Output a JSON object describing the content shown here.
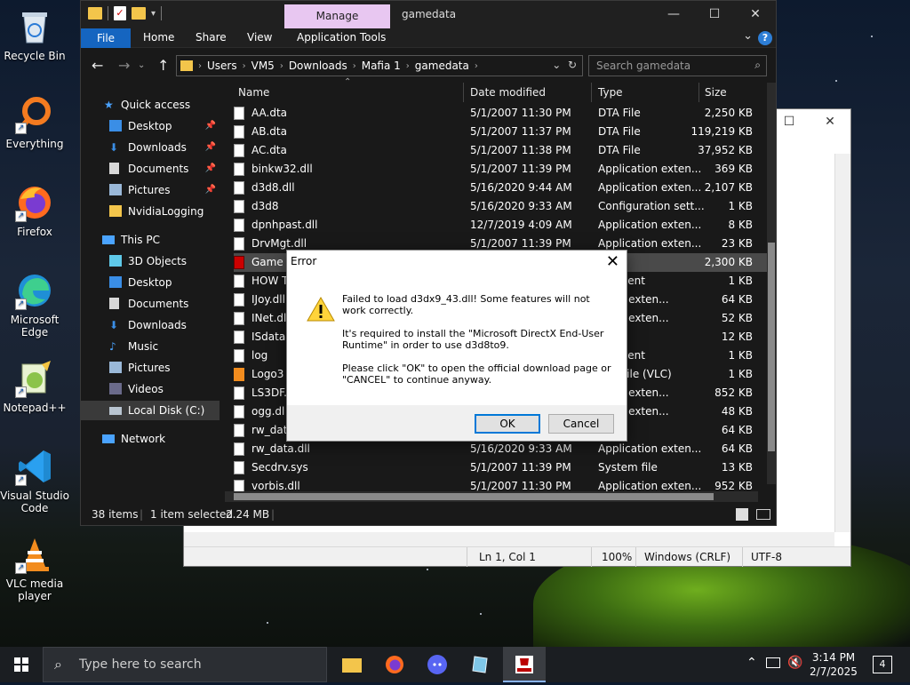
{
  "desktop": {
    "icons": [
      {
        "label": "Recycle Bin"
      },
      {
        "label": "Everything"
      },
      {
        "label": "Firefox"
      },
      {
        "label": "Microsoft Edge"
      },
      {
        "label": "Notepad++"
      },
      {
        "label": "Visual Studio Code"
      },
      {
        "label": "VLC media player"
      }
    ]
  },
  "notepad": {
    "status": {
      "position": "Ln 1, Col 1",
      "zoom": "100%",
      "line_endings": "Windows (CRLF)",
      "encoding": "UTF-8"
    }
  },
  "explorer": {
    "manage_tab": "Manage",
    "title": "gamedata",
    "ribbon": {
      "file": "File",
      "home": "Home",
      "share": "Share",
      "view": "View",
      "app_tools": "Application Tools"
    },
    "address": [
      "Users",
      "VM5",
      "Downloads",
      "Mafia 1",
      "gamedata"
    ],
    "search_placeholder": "Search gamedata",
    "nav": {
      "quick_access": "Quick access",
      "desktop": "Desktop",
      "downloads": "Downloads",
      "documents": "Documents",
      "pictures": "Pictures",
      "nvidia": "NvidiaLogging",
      "this_pc": "This PC",
      "objects3d": "3D Objects",
      "desktop2": "Desktop",
      "documents2": "Documents",
      "downloads2": "Downloads",
      "music": "Music",
      "pictures2": "Pictures",
      "videos": "Videos",
      "local_disk": "Local Disk (C:)",
      "network": "Network"
    },
    "columns": {
      "name": "Name",
      "date": "Date modified",
      "type": "Type",
      "size": "Size"
    },
    "files": [
      {
        "name": "AA.dta",
        "date": "5/1/2007 11:30 PM",
        "type": "DTA File",
        "size": "2,250 KB"
      },
      {
        "name": "AB.dta",
        "date": "5/1/2007 11:37 PM",
        "type": "DTA File",
        "size": "119,219 KB"
      },
      {
        "name": "AC.dta",
        "date": "5/1/2007 11:38 PM",
        "type": "DTA File",
        "size": "37,952 KB"
      },
      {
        "name": "binkw32.dll",
        "date": "5/1/2007 11:39 PM",
        "type": "Application exten...",
        "size": "369 KB"
      },
      {
        "name": "d3d8.dll",
        "date": "5/16/2020 9:44 AM",
        "type": "Application exten...",
        "size": "2,107 KB"
      },
      {
        "name": "d3d8",
        "date": "5/16/2020 9:33 AM",
        "type": "Configuration sett...",
        "size": "1 KB"
      },
      {
        "name": "dpnhpast.dll",
        "date": "12/7/2019 4:09 AM",
        "type": "Application exten...",
        "size": "8 KB"
      },
      {
        "name": "DrvMgt.dll",
        "date": "5/1/2007 11:39 PM",
        "type": "Application exten...",
        "size": "23 KB"
      },
      {
        "name": "Game",
        "date": "",
        "type": "ation",
        "size": "2,300 KB"
      },
      {
        "name": "HOW T",
        "date": "",
        "type": "ocument",
        "size": "1 KB"
      },
      {
        "name": "IJoy.dll",
        "date": "",
        "type": "ation exten...",
        "size": "64 KB"
      },
      {
        "name": "INet.dll",
        "date": "",
        "type": "ation exten...",
        "size": "52 KB"
      },
      {
        "name": "ISdata.",
        "date": "",
        "type": "e",
        "size": "12 KB"
      },
      {
        "name": "log",
        "date": "",
        "type": "ocument",
        "size": "1 KB"
      },
      {
        "name": "Logo3",
        "date": "",
        "type": "deo File (VLC)",
        "size": "1 KB"
      },
      {
        "name": "LS3DF.",
        "date": "",
        "type": "ation exten...",
        "size": "852 KB"
      },
      {
        "name": "ogg.dl",
        "date": "",
        "type": "ation exten...",
        "size": "48 KB"
      },
      {
        "name": "rw_dat",
        "date": "",
        "type": "le",
        "size": "64 KB"
      },
      {
        "name": "rw_data.dll",
        "date": "5/16/2020 9:33 AM",
        "type": "Application exten...",
        "size": "64 KB"
      },
      {
        "name": "Secdrv.sys",
        "date": "5/1/2007 11:39 PM",
        "type": "System file",
        "size": "13 KB"
      },
      {
        "name": "vorbis.dll",
        "date": "5/1/2007 11:30 PM",
        "type": "Application exten...",
        "size": "952 KB"
      }
    ],
    "status": {
      "items": "38 items",
      "selected": "1 item selected",
      "size": "2.24 MB"
    }
  },
  "dialog": {
    "title": "Error",
    "line1": "Failed to load d3dx9_43.dll! Some features will not work correctly.",
    "line2": "It's required to install the \"Microsoft DirectX End-User Runtime\" in order to use d3d8to9.",
    "line3": "Please click \"OK\" to open the official download page or \"CANCEL\" to continue anyway.",
    "ok": "OK",
    "cancel": "Cancel"
  },
  "taskbar": {
    "search_placeholder": "Type here to search",
    "time": "3:14 PM",
    "date": "2/7/2025",
    "notifications": "4"
  },
  "colors": {
    "accent": "#1565c0",
    "manage_tab": "#e8c7f1",
    "folder": "#f3c54b"
  }
}
